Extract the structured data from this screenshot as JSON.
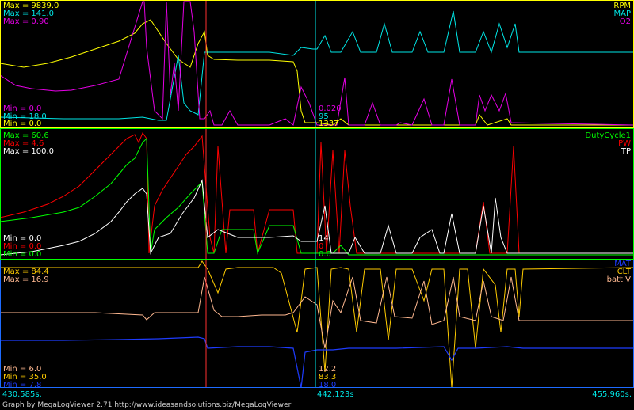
{
  "colors": {
    "rpm": "#ffff00",
    "map": "#00e6e6",
    "o2": "#e600e6",
    "duty": "#00ff00",
    "pw": "#ff0000",
    "tp": "#ffffff",
    "mat": "#1e3cff",
    "clt": "#ffcc00",
    "batt": "#ffb890",
    "cursor1": "#ff3030",
    "cursor2": "#00e6e6"
  },
  "panel1": {
    "max": [
      "Max = 9839.0",
      "Max = 141.0",
      "Max = 0.90"
    ],
    "min": [
      "Min = 0.0",
      "Min = 18.0",
      "Min = 0.0"
    ],
    "legend": [
      "RPM",
      "MAP",
      "O2"
    ],
    "cursor_values": [
      "0.020",
      "95",
      "1337"
    ]
  },
  "panel2": {
    "max": [
      "Max = 60.6",
      "Max = 4.6",
      "Max = 100.0"
    ],
    "min": [
      "Min = 0.0",
      "Min = 0.0",
      "Min = 0.0"
    ],
    "legend": [
      "DutyCycle1",
      "PW",
      "TP"
    ],
    "cursor_values": [
      "14",
      "0",
      "0.0"
    ]
  },
  "panel3": {
    "max": [
      "Max = 84.4",
      "Max = 16.9"
    ],
    "min": [
      "Min = 6.0",
      "Min = 35.0",
      "Min = 7.8"
    ],
    "legend": [
      "MAT",
      "CLT",
      "batt V"
    ],
    "cursor_values": [
      "12.2",
      "83.3",
      "18.0"
    ]
  },
  "time": {
    "start": "430.585s.",
    "cursor": "442.123s",
    "end": "455.960s."
  },
  "footer": "Graph by MegaLogViewer 2.71 http://www.ideasandsolutions.biz/MegaLogViewer"
}
